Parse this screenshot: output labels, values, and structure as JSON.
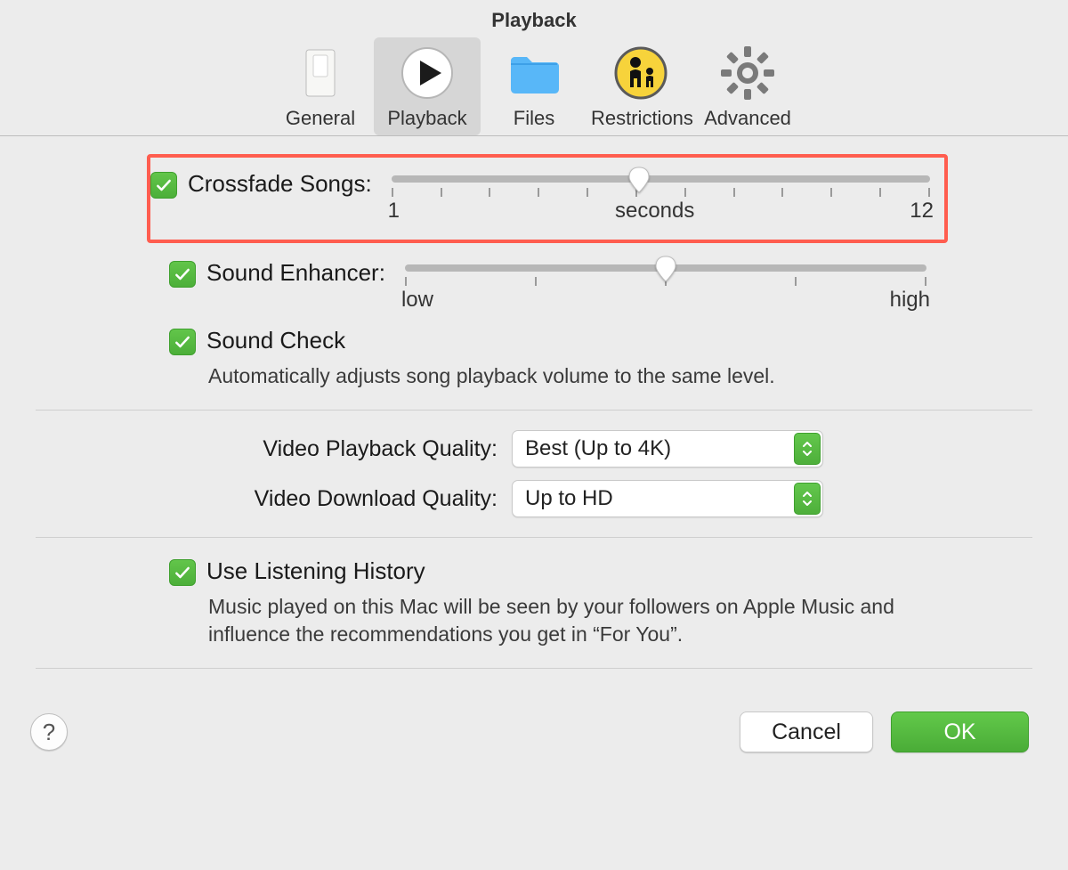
{
  "window": {
    "title": "Playback"
  },
  "toolbar": {
    "items": [
      {
        "label": "General",
        "icon": "switch-icon",
        "selected": false
      },
      {
        "label": "Playback",
        "icon": "play-icon",
        "selected": true
      },
      {
        "label": "Files",
        "icon": "folder-icon",
        "selected": false
      },
      {
        "label": "Restrictions",
        "icon": "parental-icon",
        "selected": false
      },
      {
        "label": "Advanced",
        "icon": "gear-icon",
        "selected": false
      }
    ]
  },
  "crossfade": {
    "checked": true,
    "label": "Crossfade Songs:",
    "min_label": "1",
    "center_label": "seconds",
    "max_label": "12",
    "min": 1,
    "max": 12,
    "value": 6,
    "ticks": 12,
    "thumb_pct": 46
  },
  "enhancer": {
    "checked": true,
    "label": "Sound Enhancer:",
    "min_label": "low",
    "max_label": "high",
    "ticks": 5,
    "thumb_pct": 50
  },
  "soundcheck": {
    "checked": true,
    "label": "Sound Check",
    "desc": "Automatically adjusts song playback volume to the same level."
  },
  "video_playback": {
    "label": "Video Playback Quality:",
    "value": "Best (Up to 4K)"
  },
  "video_download": {
    "label": "Video Download Quality:",
    "value": "Up to HD"
  },
  "listening_history": {
    "checked": true,
    "label": "Use Listening History",
    "desc": "Music played on this Mac will be seen by your followers on Apple Music and influence the recommendations you get in “For You”."
  },
  "footer": {
    "help": "?",
    "cancel": "Cancel",
    "ok": "OK"
  }
}
